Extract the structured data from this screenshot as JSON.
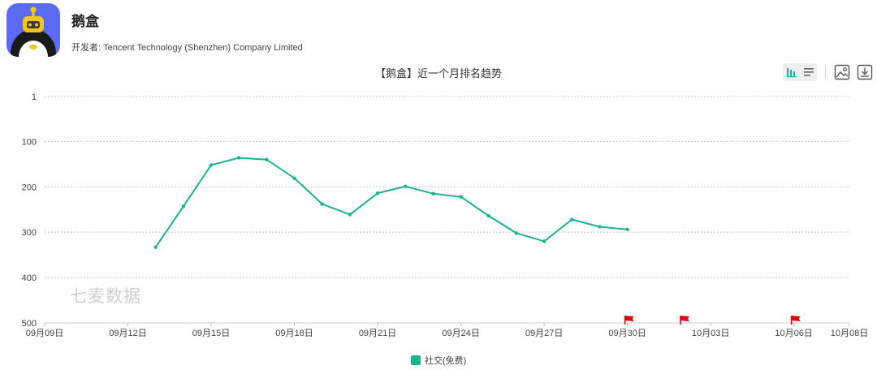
{
  "app": {
    "name": "鹅盒",
    "developer_label": "开发者:",
    "developer": "Tencent Technology (Shenzhen) Company Limited"
  },
  "toolbar": {
    "bar_chart_icon": "bar-chart-icon",
    "list_icon": "list-icon",
    "image_icon": "image-icon",
    "download_icon": "download-icon"
  },
  "watermark": "七麦数据",
  "colors": {
    "series": "#1ab394",
    "flag": "#e60012",
    "icon_bg": "#5b6cf2"
  },
  "chart_data": {
    "type": "line",
    "title": "【鹅盒】近一个月排名趋势",
    "xlabel": "",
    "ylabel": "",
    "y_inverted": true,
    "ylim": [
      1,
      500
    ],
    "yticks": [
      1,
      100,
      200,
      300,
      400,
      500
    ],
    "xlim": [
      "09月09日",
      "10月08日"
    ],
    "xticks": [
      "09月09日",
      "09月12日",
      "09月15日",
      "09月18日",
      "09月21日",
      "09月24日",
      "09月27日",
      "09月30日",
      "10月03日",
      "10月06日",
      "10月08日"
    ],
    "grid": true,
    "legend_position": "bottom",
    "series": [
      {
        "name": "社交(免费)",
        "points": [
          {
            "x": "09月13日",
            "y": 333
          },
          {
            "x": "09月14日",
            "y": 243
          },
          {
            "x": "09月15日",
            "y": 152
          },
          {
            "x": "09月16日",
            "y": 136
          },
          {
            "x": "09月17日",
            "y": 140
          },
          {
            "x": "09月18日",
            "y": 181
          },
          {
            "x": "09月19日",
            "y": 238
          },
          {
            "x": "09月20日",
            "y": 261
          },
          {
            "x": "09月21日",
            "y": 214
          },
          {
            "x": "09月22日",
            "y": 199
          },
          {
            "x": "09月23日",
            "y": 215
          },
          {
            "x": "09月24日",
            "y": 222
          },
          {
            "x": "09月25日",
            "y": 264
          },
          {
            "x": "09月26日",
            "y": 302
          },
          {
            "x": "09月27日",
            "y": 320
          },
          {
            "x": "09月28日",
            "y": 272
          },
          {
            "x": "09月29日",
            "y": 288
          },
          {
            "x": "09月30日",
            "y": 294
          }
        ]
      }
    ],
    "flags": [
      "09月30日",
      "10月02日",
      "10月06日"
    ]
  }
}
